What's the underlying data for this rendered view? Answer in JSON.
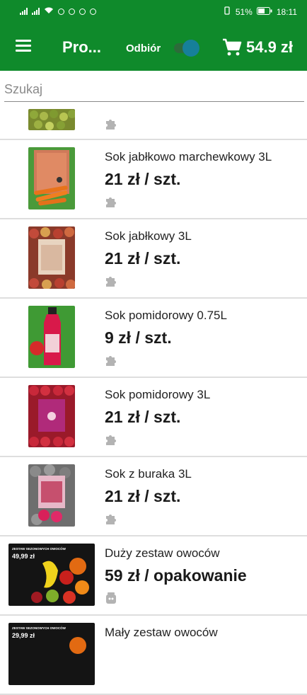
{
  "status_bar": {
    "battery": "51%",
    "time": "18:11"
  },
  "app_bar": {
    "title": "Pro...",
    "pickup_label": "Odbiór",
    "cart_total": "54.9 zł"
  },
  "search": {
    "placeholder": "Szukaj"
  },
  "products": [
    {
      "name": "",
      "price": ""
    },
    {
      "name": "Sok jabłkowo marchewkowy 3L",
      "price": "21 zł / szt."
    },
    {
      "name": "Sok jabłkowy 3L",
      "price": "21 zł / szt."
    },
    {
      "name": "Sok pomidorowy 0.75L",
      "price": "9 zł / szt."
    },
    {
      "name": "Sok pomidorowy 3L",
      "price": "21 zł / szt."
    },
    {
      "name": "Sok z buraka 3L",
      "price": "21 zł / szt."
    },
    {
      "name": "Duży zestaw owoców",
      "price": "59 zł / opakowanie",
      "banner_line1": "ZESTAW SEZONOWYCH OWOCÓW",
      "banner_price": "49,99 zł"
    },
    {
      "name": "Mały zestaw owoców",
      "price": "",
      "banner_line1": "ZESTAW SEZONOWYCH OWOCÓW",
      "banner_price": "29,99 zł"
    }
  ],
  "colors": {
    "primary": "#0f8a2b",
    "toggle_knob": "#16809a",
    "divider": "#dedede"
  },
  "icons": [
    "menu-icon",
    "cart-icon",
    "puzzle-icon",
    "jar-icon"
  ]
}
